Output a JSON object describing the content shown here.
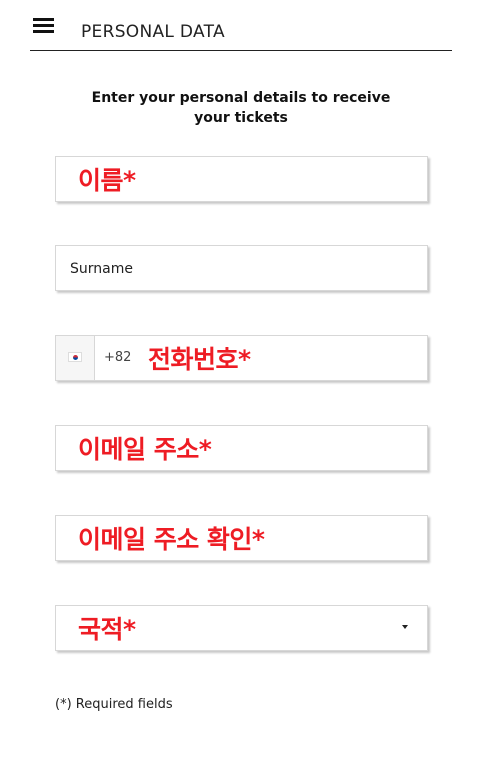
{
  "header": {
    "title": "PERSONAL DATA",
    "menu_icon": "hamburger-menu-icon"
  },
  "form": {
    "instruction": "Enter your personal details to receive your tickets",
    "fields": {
      "first_name": {
        "label": "이름*",
        "value": ""
      },
      "surname": {
        "placeholder": "Surname",
        "value": ""
      },
      "phone": {
        "country_flag": "south-korea-flag-icon",
        "dial_code": "+82",
        "label": "전화번호*",
        "value": ""
      },
      "email": {
        "label": "이메일 주소*",
        "value": ""
      },
      "email_confirm": {
        "label": "이메일 주소 확인*",
        "value": ""
      },
      "nationality": {
        "label": "국적*",
        "selected": ""
      }
    },
    "required_note": "(*) Required fields"
  },
  "colors": {
    "label_red": "#ee1c24",
    "border": "#d7d7d7",
    "text": "#111111",
    "background": "#ffffff"
  }
}
